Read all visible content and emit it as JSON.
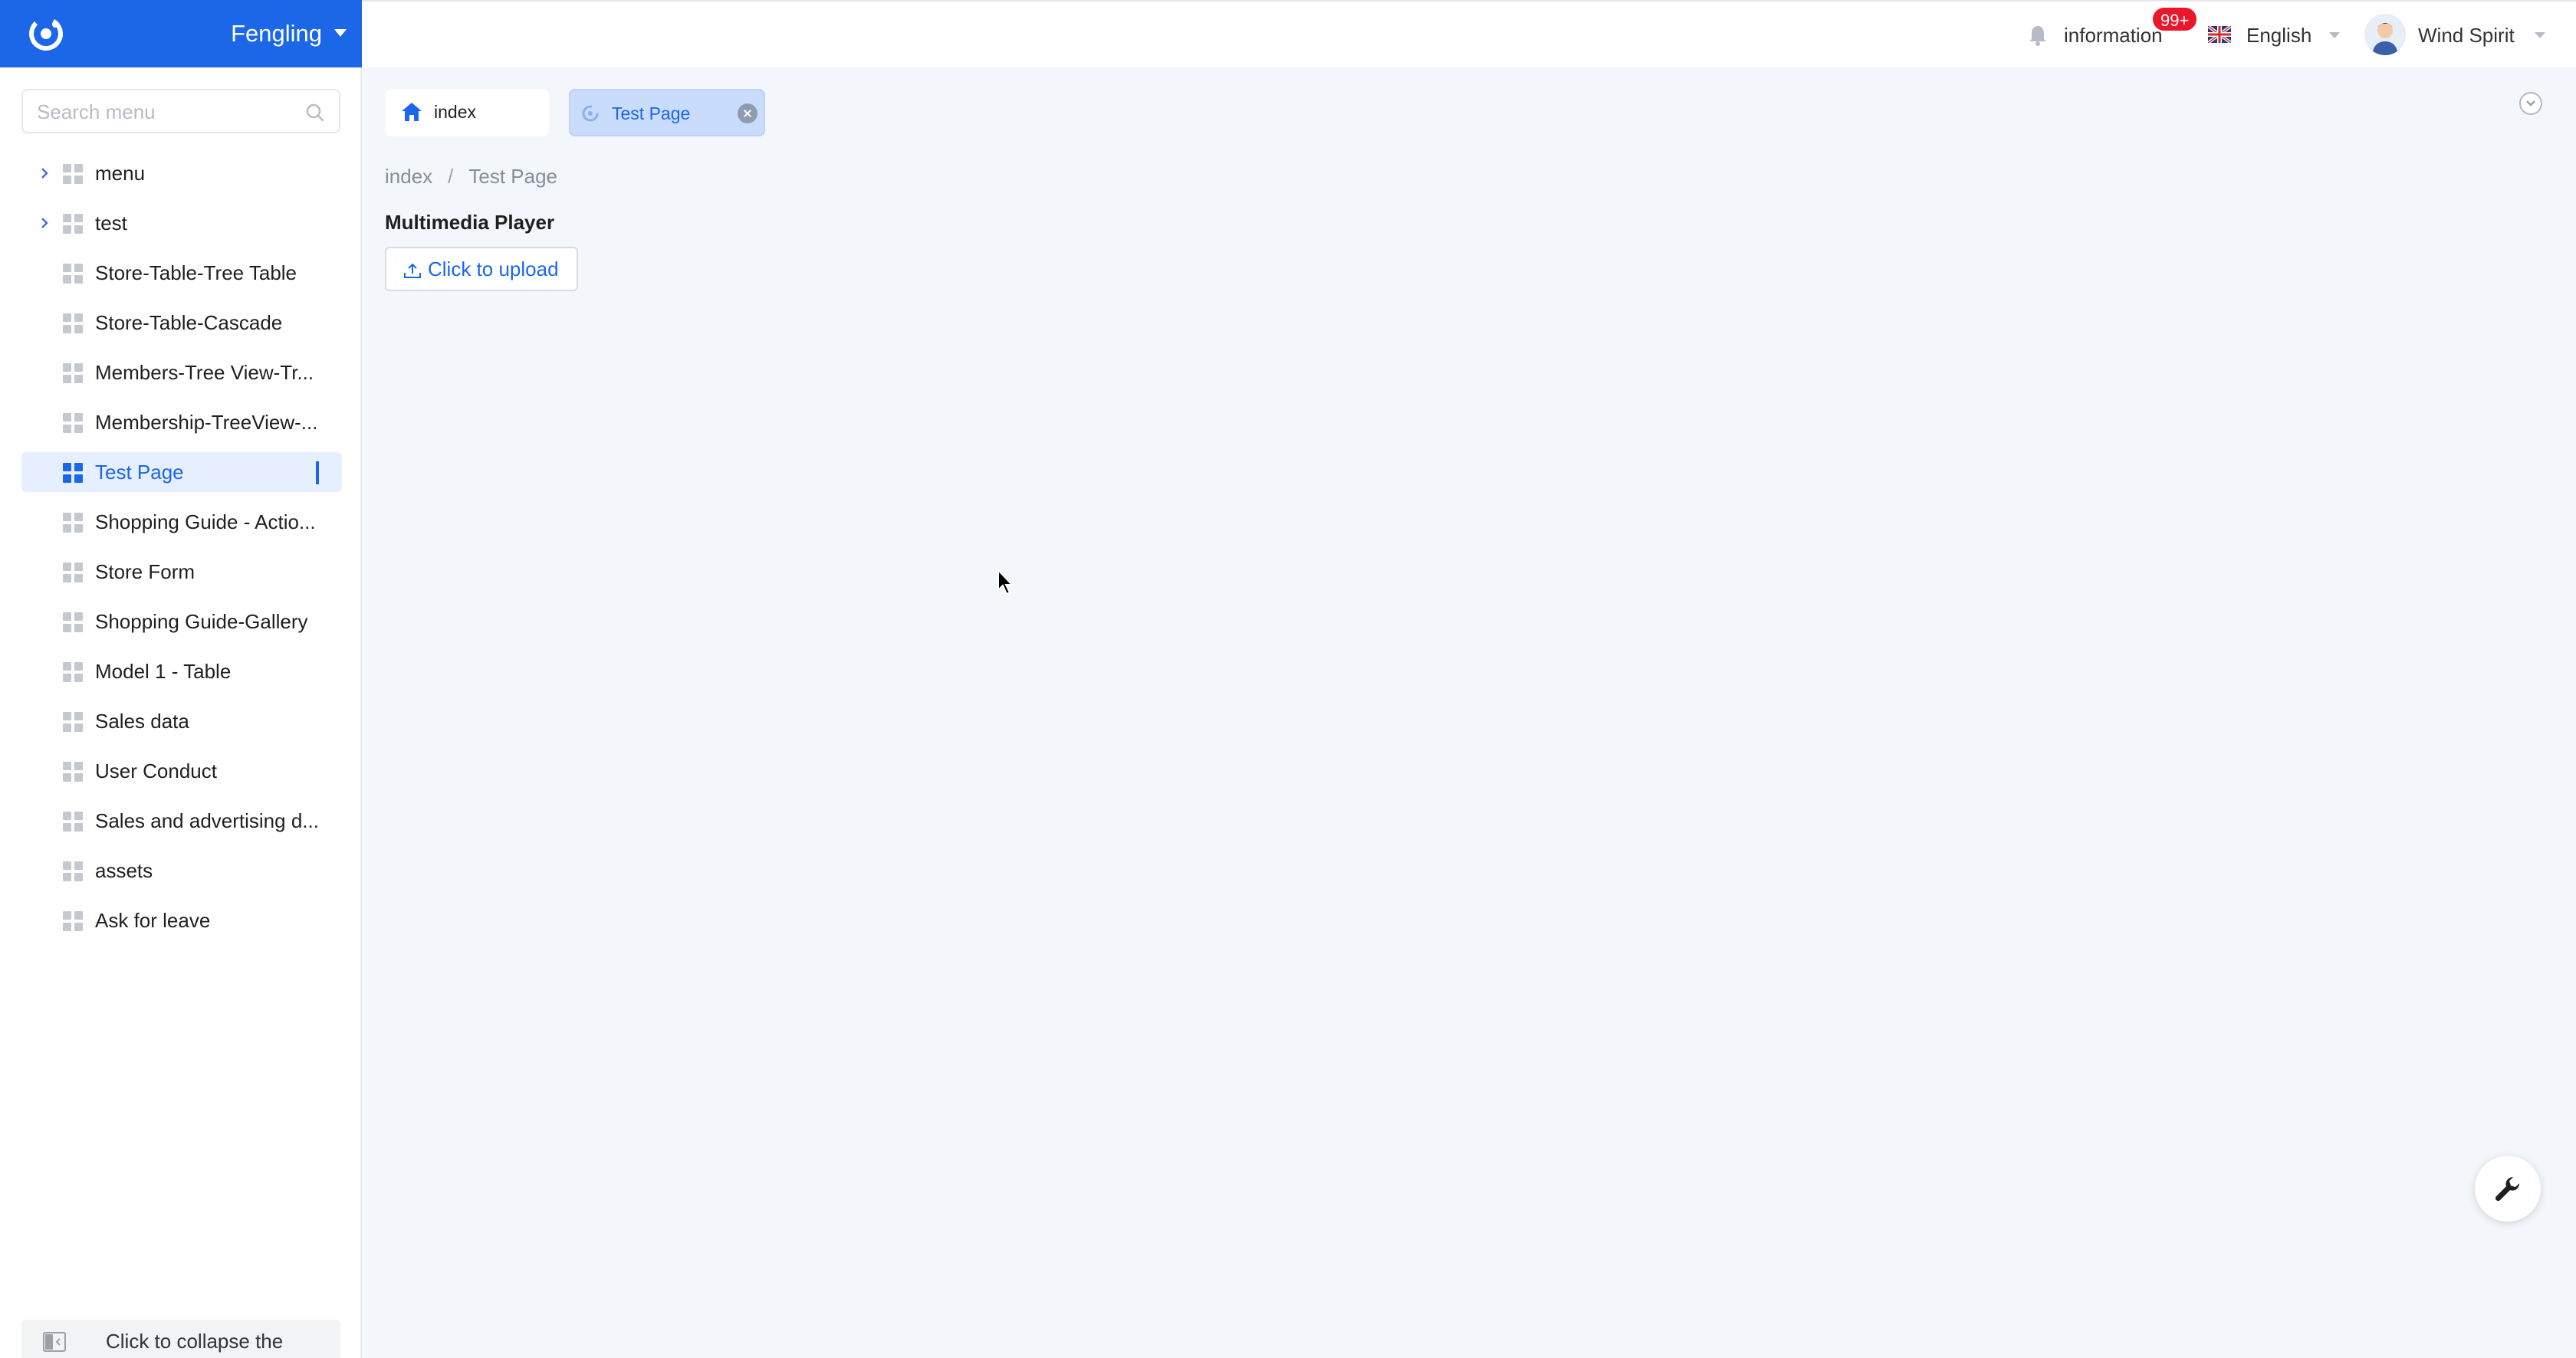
{
  "brand": {
    "name": "Fengling"
  },
  "search": {
    "placeholder": "Search menu"
  },
  "sidebar": {
    "items": [
      {
        "label": "menu",
        "expandable": true
      },
      {
        "label": "test",
        "expandable": true
      },
      {
        "label": "Store-Table-Tree Table"
      },
      {
        "label": "Store-Table-Cascade"
      },
      {
        "label": "Members-Tree View-Tr..."
      },
      {
        "label": "Membership-TreeView-..."
      },
      {
        "label": "Test Page",
        "active": true
      },
      {
        "label": "Shopping Guide - Actio..."
      },
      {
        "label": "Store Form"
      },
      {
        "label": "Shopping Guide-Gallery"
      },
      {
        "label": "Model 1 - Table"
      },
      {
        "label": "Sales data"
      },
      {
        "label": "User Conduct"
      },
      {
        "label": "Sales and advertising d..."
      },
      {
        "label": "assets"
      },
      {
        "label": "Ask for leave"
      }
    ],
    "collapse_label": "Click to collapse the"
  },
  "header": {
    "info_label": "information",
    "badge": "99+",
    "language": "English",
    "user_name": "Wind Spirit"
  },
  "tabs": [
    {
      "label": "index"
    },
    {
      "label": "Test Page"
    }
  ],
  "breadcrumb": {
    "root": "index",
    "separator": "/",
    "current": "Test Page"
  },
  "content": {
    "title": "Multimedia Player",
    "upload_label": "Click to upload"
  },
  "colors": {
    "primary": "#1b67e8",
    "badge": "#e8172b",
    "background": "#f3f6fb",
    "active_item_bg": "#e6efff"
  }
}
